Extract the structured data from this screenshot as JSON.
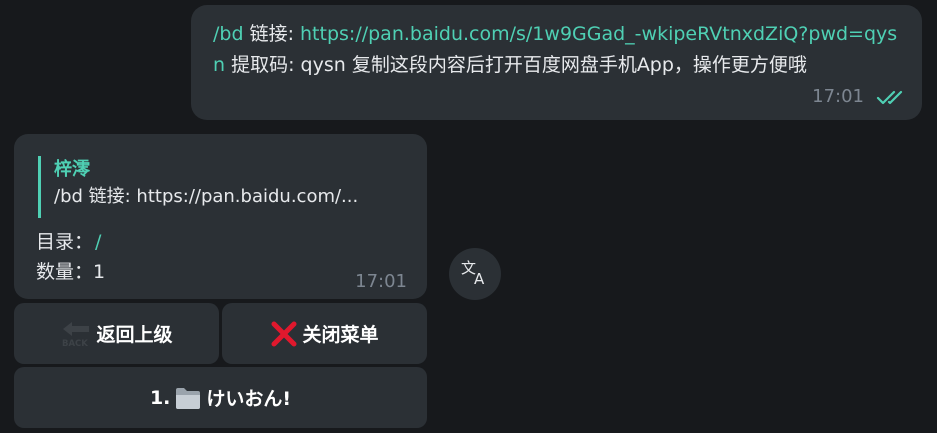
{
  "outgoing": {
    "command": "/bd",
    "label_link": " 链接: ",
    "link": "https://pan.baidu.com/s/1w9GGad_-wkipeRVtnxdZiQ?pwd=qysn",
    "rest": " 提取码: qysn 复制这段内容后打开百度网盘手机App，操作更方便哦",
    "time": "17:01"
  },
  "incoming": {
    "reply_name": "梓澪",
    "reply_snippet": "/bd 链接: https://pan.baidu.com/...",
    "line1_label": "目录：",
    "line1_value": "/",
    "line2": "数量：1",
    "time": "17:01"
  },
  "keyboard": {
    "back_label": "返回上级",
    "back_icon_text": "BACK",
    "close_label": "关闭菜单",
    "item_number": "1.",
    "item_label": "けいおん!"
  },
  "colors": {
    "accent": "#4fd0b4",
    "bubble": "#2b3035",
    "background": "#17191c",
    "close_icon": "#e0182d"
  },
  "icons": {
    "read_status": "double-check-icon",
    "translate": "translate-icon",
    "back": "back-arrow-icon",
    "close": "cross-mark-icon",
    "folder": "folder-icon"
  }
}
